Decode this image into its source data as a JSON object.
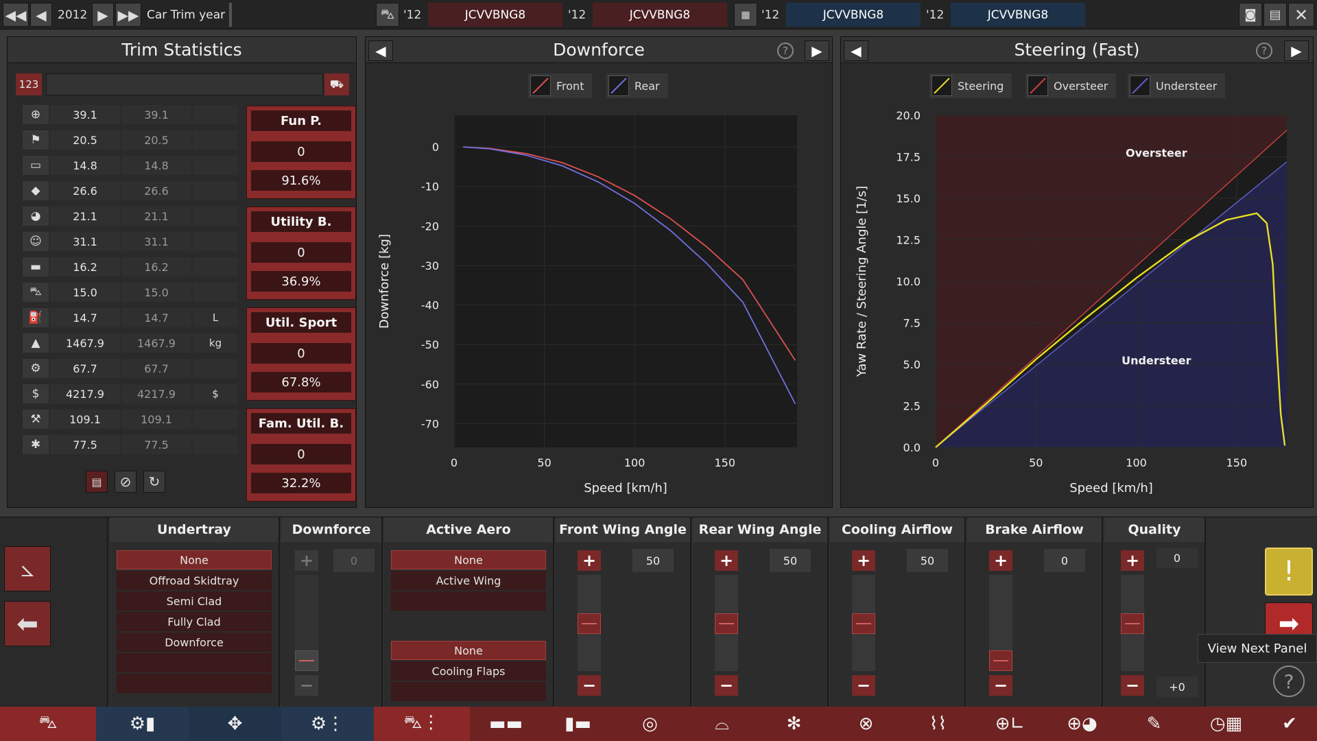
{
  "topbar": {
    "year": "2012",
    "title": "Car Trim year",
    "compare": [
      {
        "year": "'12",
        "name": "JCVVBNG8"
      },
      {
        "year": "'12",
        "name": "JCVVBNG8"
      },
      {
        "year": "'12",
        "name": "JCVVBNG8"
      },
      {
        "year": "'12",
        "name": "JCVVBNG8"
      }
    ]
  },
  "trim_stats": {
    "title": "Trim Statistics",
    "search_prefix": "123",
    "rows": [
      {
        "icon": "steering-wheel-icon",
        "v1": "39.1",
        "v2": "39.1",
        "unit": ""
      },
      {
        "icon": "race-flag-icon",
        "v1": "20.5",
        "v2": "20.5",
        "unit": ""
      },
      {
        "icon": "seat-icon",
        "v1": "14.8",
        "v2": "14.8",
        "unit": ""
      },
      {
        "icon": "diamond-icon",
        "v1": "26.6",
        "v2": "26.6",
        "unit": ""
      },
      {
        "icon": "safety-icon",
        "v1": "21.1",
        "v2": "21.1",
        "unit": ""
      },
      {
        "icon": "people-icon",
        "v1": "31.1",
        "v2": "31.1",
        "unit": ""
      },
      {
        "icon": "cargo-icon",
        "v1": "16.2",
        "v2": "16.2",
        "unit": ""
      },
      {
        "icon": "offroad-icon",
        "v1": "15.0",
        "v2": "15.0",
        "unit": ""
      },
      {
        "icon": "fuel-icon",
        "v1": "14.7",
        "v2": "14.7",
        "unit": "L"
      },
      {
        "icon": "weight-icon",
        "v1": "1467.9",
        "v2": "1467.9",
        "unit": "kg"
      },
      {
        "icon": "reliability-icon",
        "v1": "67.7",
        "v2": "67.7",
        "unit": ""
      },
      {
        "icon": "cost-icon",
        "v1": "4217.9",
        "v2": "4217.9",
        "unit": "$"
      },
      {
        "icon": "service-icon",
        "v1": "109.1",
        "v2": "109.1",
        "unit": ""
      },
      {
        "icon": "tools-icon",
        "v1": "77.5",
        "v2": "77.5",
        "unit": ""
      }
    ],
    "scores": [
      {
        "name": "Fun P.",
        "value": "0",
        "percent": "91.6%"
      },
      {
        "name": "Utility B.",
        "value": "0",
        "percent": "36.9%"
      },
      {
        "name": "Util. Sport",
        "value": "0",
        "percent": "67.8%"
      },
      {
        "name": "Fam. Util. B.",
        "value": "0",
        "percent": "32.2%"
      }
    ]
  },
  "downforce_panel": {
    "title": "Downforce",
    "legend": [
      {
        "name": "Front",
        "color": "#e05050"
      },
      {
        "name": "Rear",
        "color": "#7070e0"
      }
    ]
  },
  "steering_panel": {
    "title": "Steering (Fast)",
    "legend": [
      {
        "name": "Steering",
        "color": "#e8e020"
      },
      {
        "name": "Oversteer",
        "color": "#d04040"
      },
      {
        "name": "Understeer",
        "color": "#6060d0"
      }
    ]
  },
  "chart_data": [
    {
      "type": "line",
      "xlabel": "Speed [km/h]",
      "ylabel": "Downforce [kg]",
      "xlim": [
        0,
        190
      ],
      "ylim": [
        -76,
        8
      ],
      "xticks": [
        0,
        50,
        100,
        150
      ],
      "yticks": [
        0,
        -10,
        -20,
        -30,
        -40,
        -50,
        -60,
        -70
      ],
      "grid": true,
      "x": [
        5,
        20,
        40,
        60,
        80,
        100,
        120,
        140,
        160,
        189
      ],
      "series": [
        {
          "name": "Front",
          "color": "#e05050",
          "values": [
            0,
            -0.4,
            -1.7,
            -4.0,
            -7.6,
            -12.3,
            -18.2,
            -25.3,
            -33.6,
            -54
          ]
        },
        {
          "name": "Rear",
          "color": "#7070e0",
          "values": [
            0,
            -0.5,
            -2.1,
            -4.8,
            -8.9,
            -14.3,
            -21.2,
            -29.5,
            -39.3,
            -65
          ]
        }
      ]
    },
    {
      "type": "line",
      "xlabel": "Speed [km/h]",
      "ylabel": "Yaw Rate / Steering Angle [1/s]",
      "xlim": [
        0,
        175
      ],
      "ylim": [
        0,
        20
      ],
      "xticks": [
        0,
        50,
        100,
        150
      ],
      "yticks": [
        0.0,
        2.5,
        5.0,
        7.5,
        10.0,
        12.5,
        15.0,
        17.5,
        20.0
      ],
      "grid": true,
      "annotations": [
        "Oversteer",
        "Understeer"
      ],
      "series": [
        {
          "name": "Oversteer",
          "color": "#d04040",
          "x": [
            0,
            175
          ],
          "values": [
            0,
            19.1
          ]
        },
        {
          "name": "Understeer",
          "color": "#6060d0",
          "x": [
            0,
            175
          ],
          "values": [
            0,
            17.2
          ]
        },
        {
          "name": "Steering",
          "color": "#e8e020",
          "x": [
            0,
            25,
            50,
            75,
            100,
            125,
            145,
            160,
            165,
            168,
            170,
            172,
            174
          ],
          "values": [
            0,
            2.6,
            5.3,
            7.8,
            10.2,
            12.4,
            13.7,
            14.1,
            13.5,
            11.0,
            6.0,
            2.0,
            0.1
          ]
        }
      ]
    }
  ],
  "bottom": {
    "undertray": {
      "header": "Undertray",
      "options": [
        "None",
        "Offroad Skidtray",
        "Semi Clad",
        "Fully Clad",
        "Downforce"
      ],
      "selected": 0
    },
    "downforce": {
      "header": "Downforce",
      "value": "0"
    },
    "active_aero": {
      "header": "Active Aero",
      "options1": [
        "None",
        "Active Wing"
      ],
      "options2": [
        "None",
        "Cooling Flaps"
      ]
    },
    "front_wing": {
      "header": "Front Wing Angle",
      "value": "50",
      "level": 0.5
    },
    "rear_wing": {
      "header": "Rear Wing Angle",
      "value": "50",
      "level": 0.5
    },
    "cooling": {
      "header": "Cooling Airflow",
      "value": "50",
      "level": 0.5
    },
    "brake": {
      "header": "Brake Airflow",
      "value": "0",
      "level": 0.0
    },
    "quality": {
      "header": "Quality",
      "value": "0",
      "delta": "+0",
      "level": 0.5
    },
    "tooltip": "View Next Panel"
  }
}
